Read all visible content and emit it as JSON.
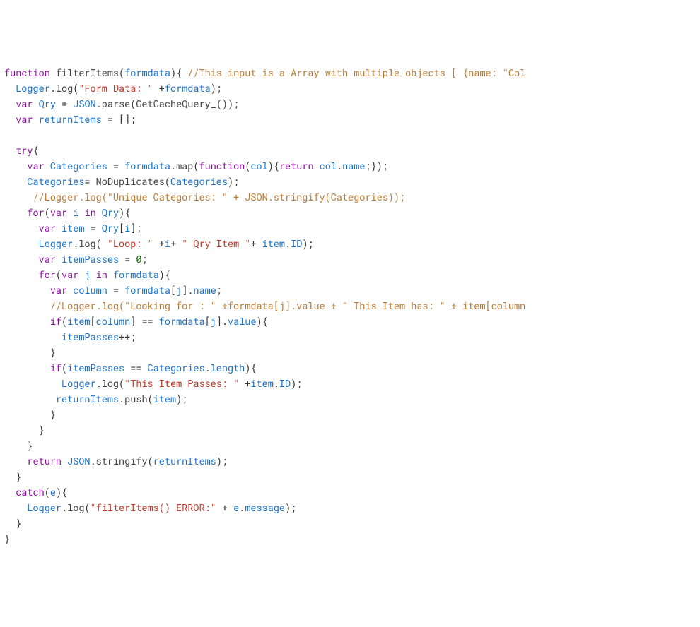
{
  "code_tokens": [
    [
      {
        "t": "function",
        "c": "kw"
      },
      {
        "t": " "
      },
      {
        "t": "filterItems",
        "c": "fn"
      },
      {
        "t": "("
      },
      {
        "t": "formdata",
        "c": "id"
      },
      {
        "t": "){ "
      },
      {
        "t": "//This input is a Array with multiple objects [ {name: \"Col",
        "c": "cmt"
      }
    ],
    [
      {
        "t": "  "
      },
      {
        "t": "Logger",
        "c": "id"
      },
      {
        "t": "."
      },
      {
        "t": "log",
        "c": "fn"
      },
      {
        "t": "("
      },
      {
        "t": "\"Form Data: \"",
        "c": "str"
      },
      {
        "t": " +"
      },
      {
        "t": "formdata",
        "c": "id"
      },
      {
        "t": ");"
      }
    ],
    [
      {
        "t": "  "
      },
      {
        "t": "var",
        "c": "kw"
      },
      {
        "t": " "
      },
      {
        "t": "Qry",
        "c": "id"
      },
      {
        "t": " = "
      },
      {
        "t": "JSON",
        "c": "id"
      },
      {
        "t": "."
      },
      {
        "t": "parse",
        "c": "fn"
      },
      {
        "t": "("
      },
      {
        "t": "GetCacheQuery_",
        "c": "fn"
      },
      {
        "t": "());"
      }
    ],
    [
      {
        "t": "  "
      },
      {
        "t": "var",
        "c": "kw"
      },
      {
        "t": " "
      },
      {
        "t": "returnItems",
        "c": "id"
      },
      {
        "t": " = [];"
      }
    ],
    [
      {
        "t": ""
      }
    ],
    [
      {
        "t": "  "
      },
      {
        "t": "try",
        "c": "kw"
      },
      {
        "t": "{"
      }
    ],
    [
      {
        "t": "    "
      },
      {
        "t": "var",
        "c": "kw"
      },
      {
        "t": " "
      },
      {
        "t": "Categories",
        "c": "id"
      },
      {
        "t": " = "
      },
      {
        "t": "formdata",
        "c": "id"
      },
      {
        "t": "."
      },
      {
        "t": "map",
        "c": "fn"
      },
      {
        "t": "("
      },
      {
        "t": "function",
        "c": "kw"
      },
      {
        "t": "("
      },
      {
        "t": "col",
        "c": "id"
      },
      {
        "t": "){"
      },
      {
        "t": "return",
        "c": "kw"
      },
      {
        "t": " "
      },
      {
        "t": "col",
        "c": "id"
      },
      {
        "t": "."
      },
      {
        "t": "name",
        "c": "id"
      },
      {
        "t": ";});"
      }
    ],
    [
      {
        "t": "    "
      },
      {
        "t": "Categories",
        "c": "id"
      },
      {
        "t": "= "
      },
      {
        "t": "NoDuplicates",
        "c": "fn"
      },
      {
        "t": "("
      },
      {
        "t": "Categories",
        "c": "id"
      },
      {
        "t": ");"
      }
    ],
    [
      {
        "t": "     "
      },
      {
        "t": "//Logger.log(\"Unique Categories: \" + JSON.stringify(Categories));",
        "c": "cmt"
      }
    ],
    [
      {
        "t": "    "
      },
      {
        "t": "for",
        "c": "kw"
      },
      {
        "t": "("
      },
      {
        "t": "var",
        "c": "kw"
      },
      {
        "t": " "
      },
      {
        "t": "i",
        "c": "id"
      },
      {
        "t": " "
      },
      {
        "t": "in",
        "c": "kw"
      },
      {
        "t": " "
      },
      {
        "t": "Qry",
        "c": "id"
      },
      {
        "t": "){"
      }
    ],
    [
      {
        "t": "      "
      },
      {
        "t": "var",
        "c": "kw"
      },
      {
        "t": " "
      },
      {
        "t": "item",
        "c": "id"
      },
      {
        "t": " = "
      },
      {
        "t": "Qry",
        "c": "id"
      },
      {
        "t": "["
      },
      {
        "t": "i",
        "c": "id"
      },
      {
        "t": "];"
      }
    ],
    [
      {
        "t": "      "
      },
      {
        "t": "Logger",
        "c": "id"
      },
      {
        "t": "."
      },
      {
        "t": "log",
        "c": "fn"
      },
      {
        "t": "( "
      },
      {
        "t": "\"Loop: \"",
        "c": "str"
      },
      {
        "t": " +"
      },
      {
        "t": "i",
        "c": "id"
      },
      {
        "t": "+ "
      },
      {
        "t": "\" Qry Item \"",
        "c": "str"
      },
      {
        "t": "+ "
      },
      {
        "t": "item",
        "c": "id"
      },
      {
        "t": "."
      },
      {
        "t": "ID",
        "c": "id"
      },
      {
        "t": ");"
      }
    ],
    [
      {
        "t": "      "
      },
      {
        "t": "var",
        "c": "kw"
      },
      {
        "t": " "
      },
      {
        "t": "itemPasses",
        "c": "id"
      },
      {
        "t": " = "
      },
      {
        "t": "0",
        "c": "num"
      },
      {
        "t": ";"
      }
    ],
    [
      {
        "t": "      "
      },
      {
        "t": "for",
        "c": "kw"
      },
      {
        "t": "("
      },
      {
        "t": "var",
        "c": "kw"
      },
      {
        "t": " "
      },
      {
        "t": "j",
        "c": "id"
      },
      {
        "t": " "
      },
      {
        "t": "in",
        "c": "kw"
      },
      {
        "t": " "
      },
      {
        "t": "formdata",
        "c": "id"
      },
      {
        "t": "){"
      }
    ],
    [
      {
        "t": "        "
      },
      {
        "t": "var",
        "c": "kw"
      },
      {
        "t": " "
      },
      {
        "t": "column",
        "c": "id"
      },
      {
        "t": " = "
      },
      {
        "t": "formdata",
        "c": "id"
      },
      {
        "t": "["
      },
      {
        "t": "j",
        "c": "id"
      },
      {
        "t": "]."
      },
      {
        "t": "name",
        "c": "id"
      },
      {
        "t": ";"
      }
    ],
    [
      {
        "t": "        "
      },
      {
        "t": "//Logger.log(\"Looking for : \" +formdata[j].value + \" This Item has: \" + item[column",
        "c": "cmt"
      }
    ],
    [
      {
        "t": "        "
      },
      {
        "t": "if",
        "c": "kw"
      },
      {
        "t": "("
      },
      {
        "t": "item",
        "c": "id"
      },
      {
        "t": "["
      },
      {
        "t": "column",
        "c": "id"
      },
      {
        "t": "] == "
      },
      {
        "t": "formdata",
        "c": "id"
      },
      {
        "t": "["
      },
      {
        "t": "j",
        "c": "id"
      },
      {
        "t": "]."
      },
      {
        "t": "value",
        "c": "id"
      },
      {
        "t": "){"
      }
    ],
    [
      {
        "t": "          "
      },
      {
        "t": "itemPasses",
        "c": "id"
      },
      {
        "t": "++;"
      }
    ],
    [
      {
        "t": "        }"
      }
    ],
    [
      {
        "t": "        "
      },
      {
        "t": "if",
        "c": "kw"
      },
      {
        "t": "("
      },
      {
        "t": "itemPasses",
        "c": "id"
      },
      {
        "t": " == "
      },
      {
        "t": "Categories",
        "c": "id"
      },
      {
        "t": "."
      },
      {
        "t": "length",
        "c": "id"
      },
      {
        "t": "){"
      }
    ],
    [
      {
        "t": "          "
      },
      {
        "t": "Logger",
        "c": "id"
      },
      {
        "t": "."
      },
      {
        "t": "log",
        "c": "fn"
      },
      {
        "t": "("
      },
      {
        "t": "\"This Item Passes: \"",
        "c": "str"
      },
      {
        "t": " +"
      },
      {
        "t": "item",
        "c": "id"
      },
      {
        "t": "."
      },
      {
        "t": "ID",
        "c": "id"
      },
      {
        "t": ");"
      }
    ],
    [
      {
        "t": "         "
      },
      {
        "t": "returnItems",
        "c": "id"
      },
      {
        "t": "."
      },
      {
        "t": "push",
        "c": "fn"
      },
      {
        "t": "("
      },
      {
        "t": "item",
        "c": "id"
      },
      {
        "t": ");"
      }
    ],
    [
      {
        "t": "        }"
      }
    ],
    [
      {
        "t": "      }"
      }
    ],
    [
      {
        "t": "    }"
      }
    ],
    [
      {
        "t": "    "
      },
      {
        "t": "return",
        "c": "kw"
      },
      {
        "t": " "
      },
      {
        "t": "JSON",
        "c": "id"
      },
      {
        "t": "."
      },
      {
        "t": "stringify",
        "c": "fn"
      },
      {
        "t": "("
      },
      {
        "t": "returnItems",
        "c": "id"
      },
      {
        "t": ");"
      }
    ],
    [
      {
        "t": "  }"
      }
    ],
    [
      {
        "t": "  "
      },
      {
        "t": "catch",
        "c": "kw"
      },
      {
        "t": "("
      },
      {
        "t": "e",
        "c": "id"
      },
      {
        "t": "){"
      }
    ],
    [
      {
        "t": "    "
      },
      {
        "t": "Logger",
        "c": "id"
      },
      {
        "t": "."
      },
      {
        "t": "log",
        "c": "fn"
      },
      {
        "t": "("
      },
      {
        "t": "\"filterItems() ERROR:\"",
        "c": "str"
      },
      {
        "t": " + "
      },
      {
        "t": "e",
        "c": "id"
      },
      {
        "t": "."
      },
      {
        "t": "message",
        "c": "id"
      },
      {
        "t": ");"
      }
    ],
    [
      {
        "t": "  }"
      }
    ],
    [
      {
        "t": "}"
      }
    ]
  ]
}
